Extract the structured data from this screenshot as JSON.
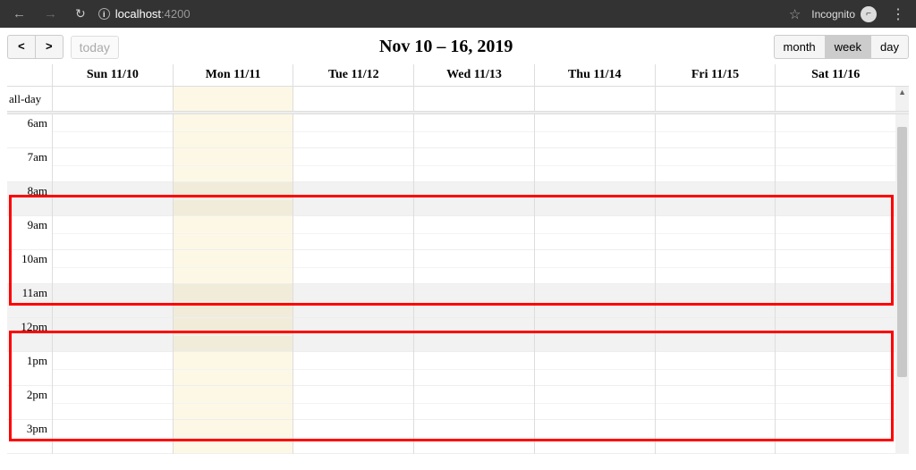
{
  "browser": {
    "host": "localhost",
    "port": ":4200",
    "incognito_label": "Incognito"
  },
  "toolbar": {
    "prev": "<",
    "next": ">",
    "today": "today",
    "title": "Nov 10 – 16, 2019",
    "views": {
      "month": "month",
      "week": "week",
      "day": "day"
    },
    "active_view": "week"
  },
  "calendar": {
    "allday_label": "all-day",
    "days": [
      {
        "label": "Sun 11/10",
        "today": false
      },
      {
        "label": "Mon 11/11",
        "today": true
      },
      {
        "label": "Tue 11/12",
        "today": false
      },
      {
        "label": "Wed 11/13",
        "today": false
      },
      {
        "label": "Thu 11/14",
        "today": false
      },
      {
        "label": "Fri 11/15",
        "today": false
      },
      {
        "label": "Sat 11/16",
        "today": false
      }
    ],
    "hours": [
      {
        "label": "6am",
        "shaded": false
      },
      {
        "label": "7am",
        "shaded": false
      },
      {
        "label": "8am",
        "shaded": true
      },
      {
        "label": "9am",
        "shaded": false
      },
      {
        "label": "10am",
        "shaded": false
      },
      {
        "label": "11am",
        "shaded": true
      },
      {
        "label": "12pm",
        "shaded": true
      },
      {
        "label": "1pm",
        "shaded": false
      },
      {
        "label": "2pm",
        "shaded": false
      },
      {
        "label": "3pm",
        "shaded": false
      }
    ],
    "highlights": [
      {
        "start_hour_index": 2,
        "end_hour_index": 6
      },
      {
        "start_hour_index": 6,
        "end_hour_index": 10
      }
    ]
  }
}
